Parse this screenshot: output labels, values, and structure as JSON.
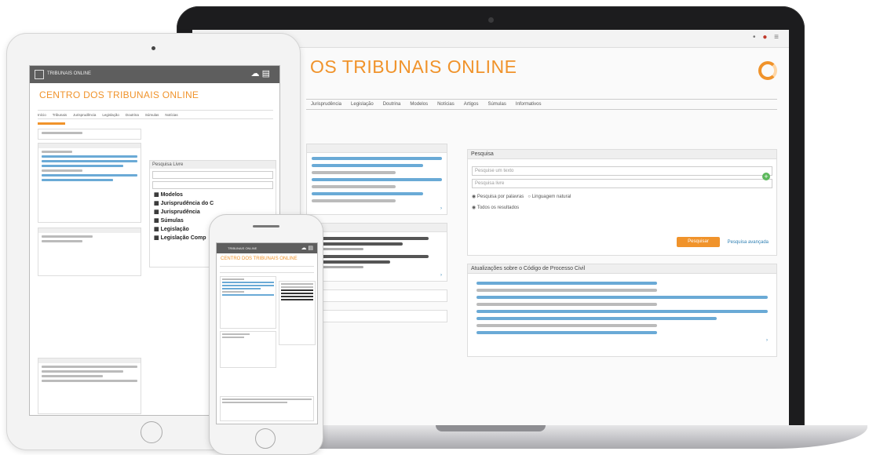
{
  "laptop": {
    "site_title": "OS TRIBUNAIS ONLINE",
    "logo_text": "",
    "top_links": [],
    "pesquisa_heading": "Pesquisa",
    "pesquisa_field1": "Pesquise um texto",
    "pesquisa_field2": "Pesquisa livre",
    "radio1": "Pesquisa por palavras",
    "radio2": "Linguagem natural",
    "radio3": "Todos os resultados",
    "button_label": "Pesquisar",
    "adv_link": "Pesquisa avançada",
    "insights_heading": "Atualizações sobre o Código de Processo Civil",
    "nav_items": [
      "Jurisprudência",
      "Legislação",
      "Doutrina",
      "Modelos",
      "Notícias",
      "Artigos",
      "Súmulas",
      "Informativos"
    ]
  },
  "tablet": {
    "topbar_label": "TRIBUNAIS ONLINE",
    "title": "CENTRO DOS TRIBUNAIS ONLINE",
    "nav_items": [
      "Início",
      "Tribunais",
      "Jurisprudência",
      "Legislação",
      "Doutrina",
      "Súmulas",
      "Notícias"
    ],
    "search_heading": "Pesquisa Livre",
    "list": [
      "Modelos",
      "Jurisprudência do C",
      "Jurisprudência",
      "Súmulas",
      "Legislação",
      "Legislação Comp"
    ]
  },
  "phone": {
    "topbar_label": "TRIBUNAIS ONLINE",
    "title": "CENTRO DOS TRIBUNAIS ONLINE"
  }
}
